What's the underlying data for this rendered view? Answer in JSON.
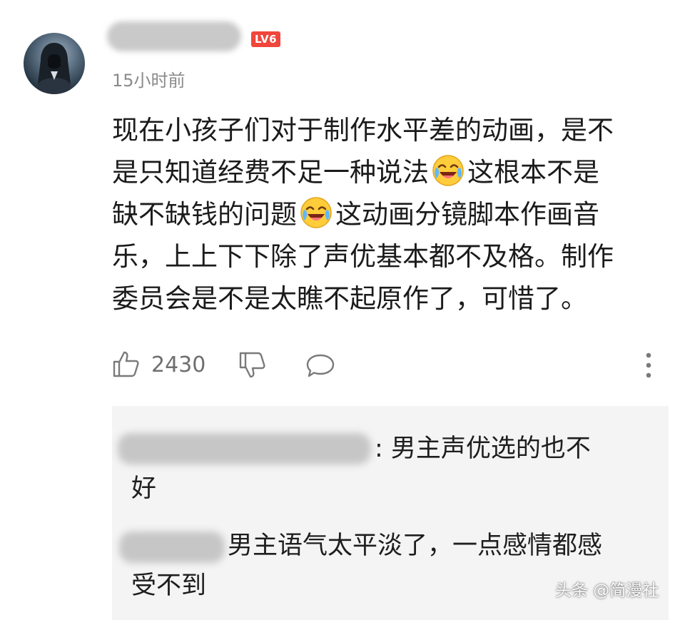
{
  "comment": {
    "author": {
      "level_badge": "LV6",
      "avatar_icon": "hooded-figure-avatar"
    },
    "timestamp": "15小时前",
    "text_lines": [
      "现在小孩子们对于制作水平差的动画，是不",
      "是只知道经费不足一种说法",
      "这根本不是",
      "缺不缺钱的问题",
      "这动画分镜脚本作画音",
      "乐，上上下下除了声优基本都不及格。制作",
      "委员会是不是太瞧不起原作了，可惜了。"
    ],
    "emoji_icon": "laughing-crying-emoji",
    "actions": {
      "like_count": "2430",
      "like_icon": "thumbs-up-icon",
      "dislike_icon": "thumbs-down-icon",
      "reply_icon": "comment-bubble-icon",
      "more_icon": "vertical-dots-icon"
    }
  },
  "replies": [
    {
      "text_lines": [
        ": 男主声优选的也不",
        "好"
      ]
    },
    {
      "text_lines": [
        "男主语气太平淡了，一点感情都感",
        "受不到"
      ]
    }
  ],
  "watermark": "头条 @简漫社",
  "colors": {
    "level_badge": "#f0463c",
    "reply_background": "#f4f4f4",
    "timestamp": "#8a8a8a"
  }
}
